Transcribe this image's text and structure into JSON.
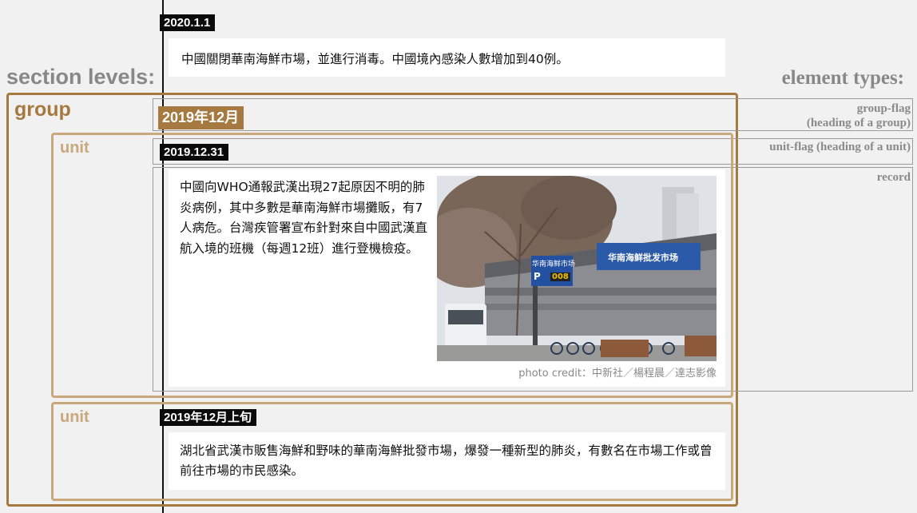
{
  "timeline": {
    "entry_2020_1_1": {
      "date": "2020.1.1",
      "text": "中國關閉華南海鮮市場，並進行消毒。中國境內感染人數增加到40例。"
    },
    "group": {
      "flag": "2019年12月",
      "units": [
        {
          "date": "2019.12.31",
          "text": "中國向WHO通報武漢出現27起原因不明的肺炎病例，其中多數是華南海鮮市場攤販，有7人病危。台灣疾管署宣布針對來自中國武漢直航入境的班機（每週12班）進行登機檢疫。",
          "photo_credit": "photo credit：中新社／楊程晨／達志影像",
          "photo_signs": [
            "华南海鲜市场",
            "P",
            "008",
            "华南海鲜批发市场"
          ]
        },
        {
          "date": "2019年12月上旬",
          "text": "湖北省武漢市販售海鮮和野味的華南海鮮批發市場，爆發一種新型的肺炎，有數名在市場工作或曾前往市場的市民感染。"
        }
      ]
    }
  },
  "annotations": {
    "section_levels_title": "section levels:",
    "level_group": "group",
    "level_unit": "unit",
    "element_types_title": "element types:",
    "types": {
      "group_flag_1": "group-flag",
      "group_flag_2": "(heading of a group)",
      "unit_flag": "unit-flag (heading of a unit)",
      "record": "record"
    }
  },
  "colors": {
    "group": "#a5793f",
    "unit": "#c9a87b",
    "type_outline": "#9a9a9a",
    "flag_bg": "#0b0b0b"
  }
}
